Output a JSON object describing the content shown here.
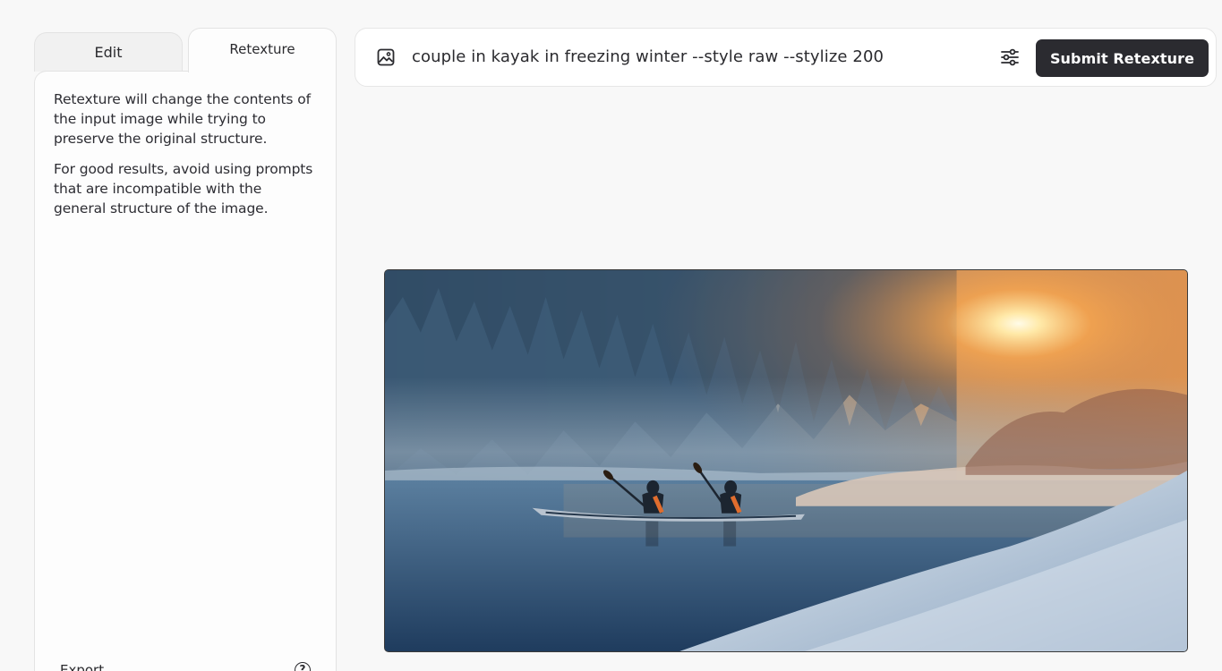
{
  "tabs": {
    "edit_label": "Edit",
    "retexture_label": "Retexture"
  },
  "panel": {
    "paragraph1": "Retexture will change the contents of the input image while trying to preserve the original structure.",
    "paragraph2": "For good results, avoid using prompts that are incompatible with the general structure of the image.",
    "footer_label": "Export",
    "help_glyph": "?"
  },
  "prompt_bar": {
    "prompt": "couple in kayak in freezing winter --style raw --stylize 200",
    "submit_label": "Submit Retexture",
    "leading_icon": "image-icon",
    "settings_icon": "sliders-icon"
  },
  "colors": {
    "accent": "#2b2b30",
    "background": "#f8f8f8",
    "panel": "#fdfdfd"
  }
}
